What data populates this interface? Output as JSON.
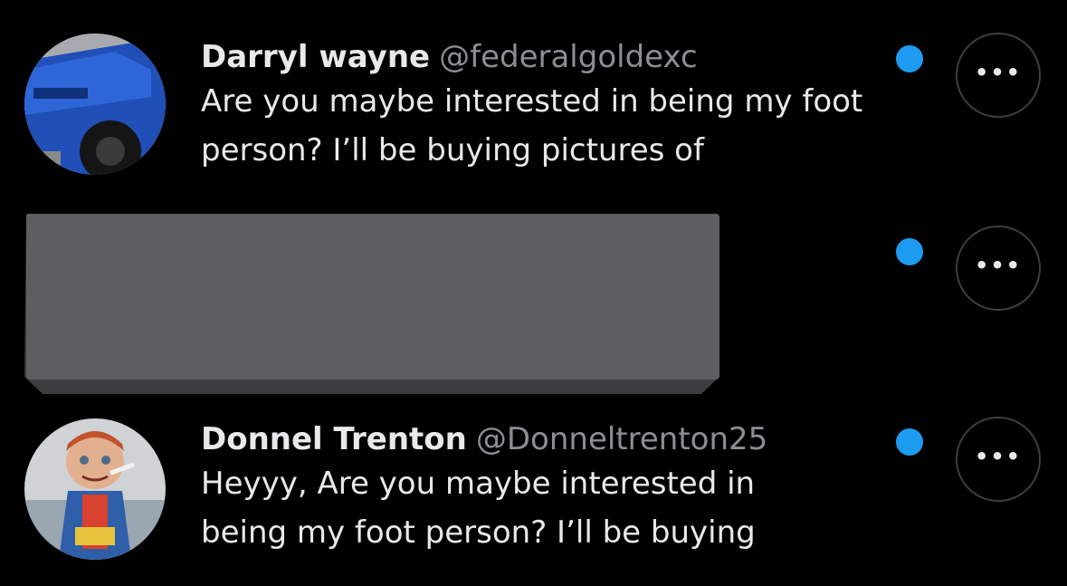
{
  "messages": [
    {
      "name": "Darryl wayne",
      "handle": "@federalgoldexc",
      "preview": "Are you maybe interested in being my foot person? I’ll be buying pictures of",
      "unread": true,
      "more_label": "•••",
      "avatar_icon": "blue-truck-avatar"
    },
    {
      "name": "",
      "handle": "",
      "preview": "",
      "unread": true,
      "more_label": "•••",
      "redacted": true
    },
    {
      "name": "Donnel Trenton",
      "handle": "@Donneltrenton25",
      "preview": "Heyyy, Are you maybe interested in being my foot person? I’ll be buying",
      "unread": true,
      "more_label": "•••",
      "avatar_icon": "doll-avatar"
    }
  ],
  "colors": {
    "background": "#000000",
    "unread_dot": "#1d9bf0",
    "handle": "#8b8f94",
    "redaction": "#5e5e60"
  }
}
